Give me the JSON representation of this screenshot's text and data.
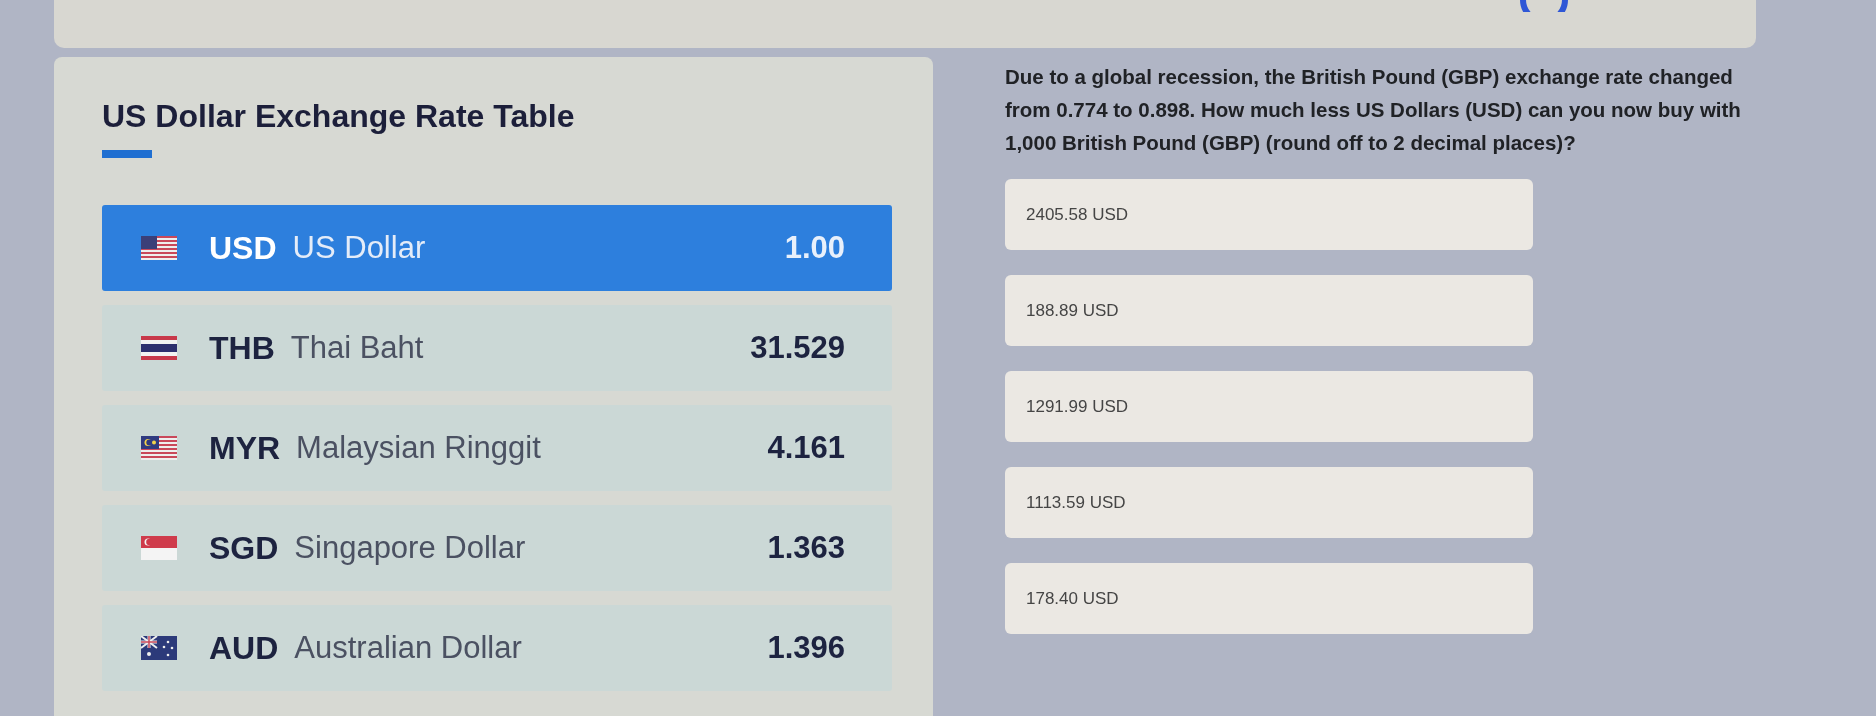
{
  "rate_table": {
    "title": "US Dollar Exchange Rate Table",
    "rows": [
      {
        "code": "USD",
        "name": "US Dollar",
        "rate": "1.00",
        "selected": true
      },
      {
        "code": "THB",
        "name": "Thai Baht",
        "rate": "31.529",
        "selected": false
      },
      {
        "code": "MYR",
        "name": "Malaysian Ringgit",
        "rate": "4.161",
        "selected": false
      },
      {
        "code": "SGD",
        "name": "Singapore Dollar",
        "rate": "1.363",
        "selected": false
      },
      {
        "code": "AUD",
        "name": "Australian Dollar",
        "rate": "1.396",
        "selected": false
      }
    ]
  },
  "question": {
    "text": "Due to a global recession, the British Pound (GBP) exchange rate changed from 0.774 to 0.898. How much less US Dollars (USD) can you now buy with 1,000 British Pound (GBP) (round off to 2 decimal places)?",
    "options": [
      {
        "label": "2405.58 USD",
        "selected": false
      },
      {
        "label": "188.89 USD",
        "selected": false
      },
      {
        "label": "1291.99 USD",
        "selected": false
      },
      {
        "label": "1113.59 USD",
        "selected": false
      },
      {
        "label": "178.40 USD",
        "selected": false
      }
    ]
  }
}
